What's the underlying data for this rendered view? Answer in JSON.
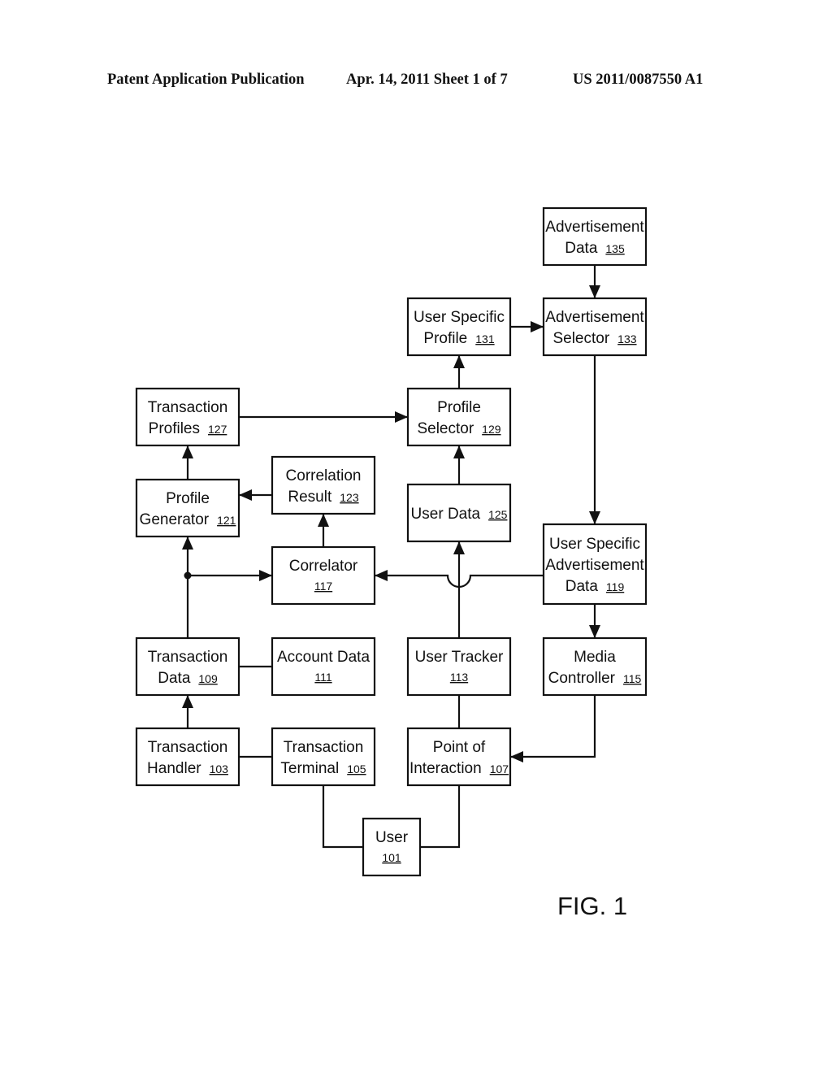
{
  "header": {
    "left": "Patent Application Publication",
    "middle": "Apr. 14, 2011  Sheet 1 of 7",
    "right": "US 2011/0087550 A1"
  },
  "figure_label": "FIG. 1",
  "nodes": [
    {
      "id": "advertisement-data",
      "lines": [
        "Advertisement",
        "Data"
      ],
      "ref": "135"
    },
    {
      "id": "user-specific-profile",
      "lines": [
        "User Specific",
        "Profile"
      ],
      "ref": "131"
    },
    {
      "id": "advertisement-selector",
      "lines": [
        "Advertisement",
        "Selector"
      ],
      "ref": "133"
    },
    {
      "id": "transaction-profiles",
      "lines": [
        "Transaction",
        "Profiles"
      ],
      "ref": "127"
    },
    {
      "id": "profile-selector",
      "lines": [
        "Profile",
        "Selector"
      ],
      "ref": "129"
    },
    {
      "id": "profile-generator",
      "lines": [
        "Profile",
        "Generator"
      ],
      "ref": "121"
    },
    {
      "id": "correlation-result",
      "lines": [
        "Correlation",
        "Result"
      ],
      "ref": "123"
    },
    {
      "id": "user-data",
      "lines": [
        "User Data"
      ],
      "ref": "125"
    },
    {
      "id": "correlator",
      "lines": [
        "Correlator"
      ],
      "ref": "117"
    },
    {
      "id": "user-specific-advertisement-data",
      "lines": [
        "User Specific",
        "Advertisement",
        "Data"
      ],
      "ref": "119"
    },
    {
      "id": "transaction-data",
      "lines": [
        "Transaction",
        "Data"
      ],
      "ref": "109"
    },
    {
      "id": "account-data",
      "lines": [
        "Account Data"
      ],
      "ref": "111"
    },
    {
      "id": "user-tracker",
      "lines": [
        "User Tracker"
      ],
      "ref": "113"
    },
    {
      "id": "media-controller",
      "lines": [
        "Media",
        "Controller"
      ],
      "ref": "115"
    },
    {
      "id": "transaction-handler",
      "lines": [
        "Transaction",
        "Handler"
      ],
      "ref": "103"
    },
    {
      "id": "transaction-terminal",
      "lines": [
        "Transaction",
        "Terminal"
      ],
      "ref": "105"
    },
    {
      "id": "point-of-interaction",
      "lines": [
        "Point of",
        "Interaction"
      ],
      "ref": "107"
    },
    {
      "id": "user",
      "lines": [
        "User"
      ],
      "ref": "101"
    }
  ],
  "edges": [
    {
      "from": "advertisement-data",
      "to": "advertisement-selector",
      "arrow": true
    },
    {
      "from": "user-specific-profile",
      "to": "advertisement-selector",
      "arrow": true
    },
    {
      "from": "profile-selector",
      "to": "user-specific-profile",
      "arrow": true
    },
    {
      "from": "transaction-profiles",
      "to": "profile-selector",
      "arrow": true
    },
    {
      "from": "user-data",
      "to": "profile-selector",
      "arrow": true
    },
    {
      "from": "profile-generator",
      "to": "transaction-profiles",
      "arrow": true
    },
    {
      "from": "correlation-result",
      "to": "profile-generator",
      "arrow": true
    },
    {
      "from": "correlator",
      "to": "correlation-result",
      "arrow": true
    },
    {
      "from": "transaction-data",
      "to": "profile-generator",
      "arrow": true
    },
    {
      "from": "transaction-data",
      "to": "correlator",
      "arrow": true
    },
    {
      "from": "user-specific-advertisement-data",
      "to": "correlator",
      "arrow": true
    },
    {
      "from": "advertisement-selector",
      "to": "user-specific-advertisement-data",
      "arrow": true
    },
    {
      "from": "user-tracker",
      "to": "user-data",
      "arrow": true
    },
    {
      "from": "user-specific-advertisement-data",
      "to": "media-controller",
      "arrow": true
    },
    {
      "from": "transaction-data",
      "to": "account-data",
      "arrow": false
    },
    {
      "from": "transaction-handler",
      "to": "transaction-data",
      "arrow": true
    },
    {
      "from": "transaction-handler",
      "to": "transaction-terminal",
      "arrow": false
    },
    {
      "from": "user-tracker",
      "to": "point-of-interaction",
      "arrow": false
    },
    {
      "from": "media-controller",
      "to": "point-of-interaction",
      "arrow": true
    },
    {
      "from": "transaction-terminal",
      "to": "user",
      "arrow": false
    },
    {
      "from": "point-of-interaction",
      "to": "user",
      "arrow": false
    }
  ]
}
